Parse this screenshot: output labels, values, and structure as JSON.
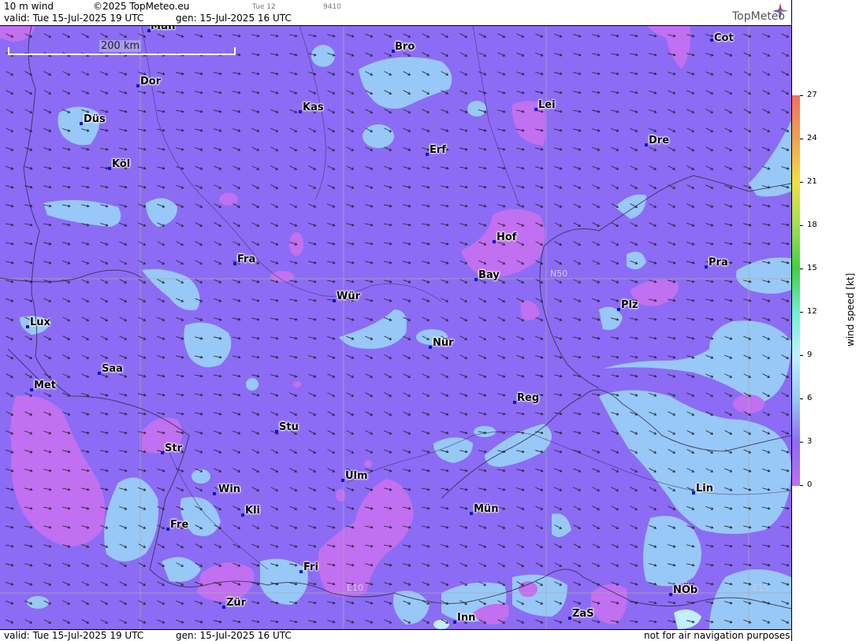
{
  "header": {
    "product": "10 m wind",
    "copyright": "©2025 TopMeteo.eu",
    "run_tag": "Tue 12",
    "code": "9410",
    "valid": "valid:  Tue  15-Jul-2025  19 UTC",
    "generated": "gen: 15-Jul-2025 16 UTC",
    "logo": "TopMeteo"
  },
  "map": {
    "scale_label": "200 km",
    "grid_labels": {
      "lat": "N50",
      "lon1": "E10",
      "lon2": "E15"
    },
    "cities": [
      {
        "name": "Mün",
        "key": "mun_n"
      },
      {
        "name": "Bro"
      },
      {
        "name": "Cot"
      },
      {
        "name": "Dor"
      },
      {
        "name": "Kas"
      },
      {
        "name": "Lei"
      },
      {
        "name": "Düs"
      },
      {
        "name": "Erf"
      },
      {
        "name": "Dre"
      },
      {
        "name": "Köl"
      },
      {
        "name": "Hof"
      },
      {
        "name": "Fra"
      },
      {
        "name": "Pra"
      },
      {
        "name": "Bay"
      },
      {
        "name": "Wür"
      },
      {
        "name": "Plz"
      },
      {
        "name": "Lux"
      },
      {
        "name": "Nür"
      },
      {
        "name": "Saa"
      },
      {
        "name": "Met"
      },
      {
        "name": "Reg"
      },
      {
        "name": "Stu"
      },
      {
        "name": "Str"
      },
      {
        "name": "Ulm"
      },
      {
        "name": "Win"
      },
      {
        "name": "Lin"
      },
      {
        "name": "Kli"
      },
      {
        "name": "Mün",
        "key": "mun_s"
      },
      {
        "name": "Fre"
      },
      {
        "name": "Fri"
      },
      {
        "name": "NÖb"
      },
      {
        "name": "Zür"
      },
      {
        "name": "ZaS"
      },
      {
        "name": "Inn"
      }
    ]
  },
  "footer": {
    "valid": "valid:  Tue  15-Jul-2025  19 UTC",
    "generated": "gen: 15-Jul-2025 16 UTC",
    "disclaimer": "not for air navigation purposes"
  },
  "legend": {
    "title": "wind speed [kt]",
    "ticks": [
      "27",
      "24",
      "21",
      "18",
      "15",
      "12",
      "9",
      "6",
      "3",
      "0"
    ],
    "colors": [
      "#f07060",
      "#f5a050",
      "#f0e040",
      "#a0e050",
      "#40d040",
      "#70f0d0",
      "#c0f0ff",
      "#98c8f8",
      "#8c6cf4",
      "#c070f0"
    ]
  }
}
